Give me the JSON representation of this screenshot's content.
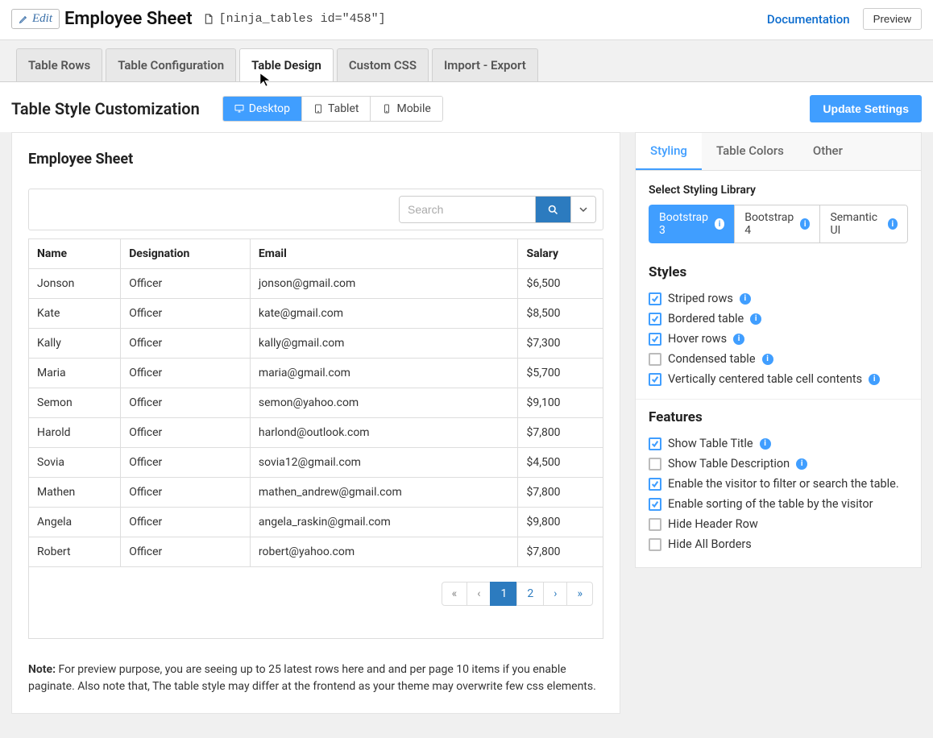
{
  "header": {
    "edit_label": "Edit",
    "page_title": "Employee Sheet",
    "shortcode": "[ninja_tables id=\"458\"]",
    "doc_link": "Documentation",
    "preview_label": "Preview"
  },
  "tabs": [
    {
      "label": "Table Rows",
      "active": false
    },
    {
      "label": "Table Configuration",
      "active": false
    },
    {
      "label": "Table Design",
      "active": true
    },
    {
      "label": "Custom CSS",
      "active": false
    },
    {
      "label": "Import - Export",
      "active": false
    }
  ],
  "subheader": {
    "title": "Table Style Customization",
    "devices": [
      {
        "label": "Desktop",
        "active": true
      },
      {
        "label": "Tablet",
        "active": false
      },
      {
        "label": "Mobile",
        "active": false
      }
    ],
    "update_label": "Update Settings"
  },
  "preview": {
    "table_title": "Employee Sheet",
    "search_placeholder": "Search",
    "columns": [
      "Name",
      "Designation",
      "Email",
      "Salary"
    ],
    "rows": [
      {
        "name": "Jonson",
        "designation": "Officer",
        "email": "jonson@gmail.com",
        "salary": "$6,500"
      },
      {
        "name": "Kate",
        "designation": "Officer",
        "email": "kate@gmail.com",
        "salary": "$8,500"
      },
      {
        "name": "Kally",
        "designation": "Officer",
        "email": "kally@gmail.com",
        "salary": "$7,300"
      },
      {
        "name": "Maria",
        "designation": "Officer",
        "email": "maria@gmail.com",
        "salary": "$5,700"
      },
      {
        "name": "Semon",
        "designation": "Officer",
        "email": "semon@yahoo.com",
        "salary": "$9,100"
      },
      {
        "name": "Harold",
        "designation": "Officer",
        "email": "harlond@outlook.com",
        "salary": "$7,800"
      },
      {
        "name": "Sovia",
        "designation": "Officer",
        "email": "sovia12@gmail.com",
        "salary": "$4,500"
      },
      {
        "name": "Mathen",
        "designation": "Officer",
        "email": "mathen_andrew@gmail.com",
        "salary": "$7,800"
      },
      {
        "name": "Angela",
        "designation": "Officer",
        "email": "angela_raskin@gmail.com",
        "salary": "$9,800"
      },
      {
        "name": "Robert",
        "designation": "Officer",
        "email": "robert@yahoo.com",
        "salary": "$7,800"
      }
    ],
    "pagination": {
      "first": "«",
      "prev": "‹",
      "pages": [
        "1",
        "2"
      ],
      "active": "1",
      "next": "›",
      "last": "»"
    },
    "note_label": "Note:",
    "note_text": "For preview purpose, you are seeing up to 25 latest rows here and and per page 10 items if you enable paginate. Also note that, The table style may differ at the frontend as your theme may overwrite few css elements."
  },
  "right": {
    "tabs": [
      {
        "label": "Styling",
        "active": true
      },
      {
        "label": "Table Colors",
        "active": false
      },
      {
        "label": "Other",
        "active": false
      }
    ],
    "library_label": "Select Styling Library",
    "libraries": [
      {
        "label": "Bootstrap 3",
        "active": true
      },
      {
        "label": "Bootstrap 4",
        "active": false
      },
      {
        "label": "Semantic UI",
        "active": false
      }
    ],
    "styles_heading": "Styles",
    "styles": [
      {
        "label": "Striped rows",
        "checked": true,
        "info": true
      },
      {
        "label": "Bordered table",
        "checked": true,
        "info": true
      },
      {
        "label": "Hover rows",
        "checked": true,
        "info": true
      },
      {
        "label": "Condensed table",
        "checked": false,
        "info": true
      },
      {
        "label": "Vertically centered table cell contents",
        "checked": true,
        "info": true
      }
    ],
    "features_heading": "Features",
    "features": [
      {
        "label": "Show Table Title",
        "checked": true,
        "info": true
      },
      {
        "label": "Show Table Description",
        "checked": false,
        "info": true
      },
      {
        "label": "Enable the visitor to filter or search the table.",
        "checked": true,
        "info": false
      },
      {
        "label": "Enable sorting of the table by the visitor",
        "checked": true,
        "info": false
      },
      {
        "label": "Hide Header Row",
        "checked": false,
        "info": false
      },
      {
        "label": "Hide All Borders",
        "checked": false,
        "info": false
      }
    ]
  }
}
